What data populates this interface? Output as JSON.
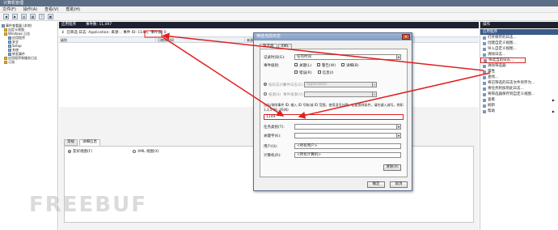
{
  "window": {
    "title": "计算机管理"
  },
  "menu": [
    "文件(F)",
    "操作(A)",
    "查看(V)",
    "帮助(H)"
  ],
  "tree": {
    "items": [
      {
        "label": "事件查看器 (本地)",
        "indent": 0
      },
      {
        "label": "自定义视图",
        "indent": 1
      },
      {
        "label": "Windows 日志",
        "indent": 1
      },
      {
        "label": "应用程序",
        "indent": 2
      },
      {
        "label": "安全",
        "indent": 2
      },
      {
        "label": "Setup",
        "indent": 2
      },
      {
        "label": "系统",
        "indent": 2
      },
      {
        "label": "转发事件",
        "indent": 2
      },
      {
        "label": "应用程序和服务日志",
        "indent": 1
      },
      {
        "label": "订阅",
        "indent": 1
      }
    ]
  },
  "center": {
    "title": "应用程序",
    "count": "事件数: 11,097",
    "filter_text": "已筛选:日志: Application; 来源: ; 事件 ID: 1149。事件数: 0",
    "columns": [
      "级别",
      "日期和时间",
      "来源",
      "事件 ID",
      "任务类别"
    ],
    "tabs": [
      "常规",
      "详细信息"
    ],
    "views": [
      "友好视图(F)",
      "XML 视图(X)"
    ]
  },
  "actions": {
    "header": "操作",
    "section": "应用程序",
    "items": [
      "打开保存的日志...",
      "创建自定义视图...",
      "导入自定义视图...",
      "清除日志...",
      "筛选当前日志...",
      "清除筛选器",
      "属性",
      "查找...",
      "将已筛选的日志文件另存为...",
      "将任务附加到此日志...",
      "将筛选器保存到自定义视图...",
      "查看",
      "刷新",
      "帮助"
    ],
    "highlighted_index": 4
  },
  "dialog": {
    "title": "筛选当前日志",
    "tabs": [
      "筛选器",
      "XML"
    ],
    "logged_label": "记录时间(G):",
    "logged_value": "任何时间",
    "level_label": "事件级别:",
    "levels": [
      "关键(L)",
      "警告(W)",
      "详细(B)",
      "错误(R)",
      "信息(I)"
    ],
    "by_log_label": "按日志(O)",
    "by_log_field_label": "事件日志(E):",
    "by_log_value": "Application",
    "by_source_label": "按源(S)",
    "by_source_field_label": "事件来源(V):",
    "event_id_hint": "包括/排除事件 ID: 输入 ID 号和/或 ID 范围，使用逗号分隔。若要排除条件，请先键入减号。例如 1,3,5-99,-76(N)",
    "event_id_value": "1149",
    "task_label": "任务类别(T):",
    "keywords_label": "关键字(K):",
    "user_label": "用户(U):",
    "user_value": "<所有用户>",
    "computer_label": "计算机(R):",
    "computer_value": "<所有计算机>",
    "clear_button": "清除(A)",
    "ok_button": "确定",
    "cancel_button": "取消"
  },
  "watermark": "FREEBUF",
  "colors": {
    "highlight": "#e02020",
    "header": "#1e2230",
    "dialog_title": "#8ea8cb"
  }
}
